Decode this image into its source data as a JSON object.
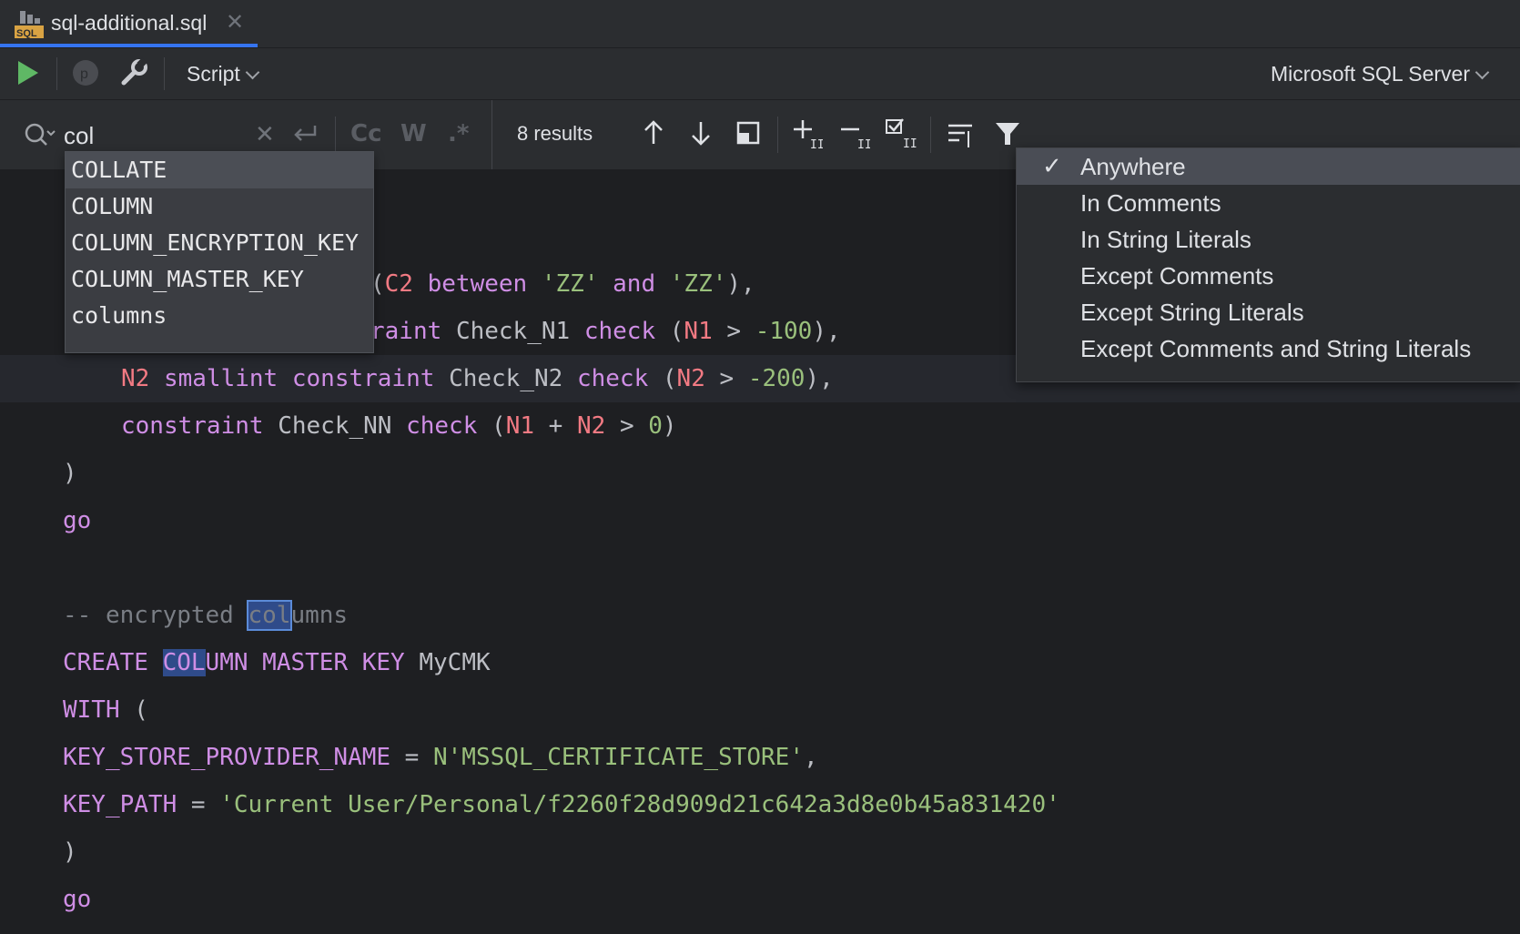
{
  "tab": {
    "filename": "sql-additional.sql",
    "icon": "sql-file-icon"
  },
  "toolbar": {
    "mode": "Script",
    "datasource": "Microsoft SQL Server"
  },
  "find": {
    "query": "col",
    "results": "8 results",
    "options": {
      "case": "Cc",
      "words": "W",
      "regex": ".*"
    }
  },
  "completion": {
    "items": [
      "COLLATE",
      "COLUMN",
      "COLUMN_ENCRYPTION_KEY",
      "COLUMN_MASTER_KEY",
      "columns"
    ]
  },
  "scope_menu": {
    "items": [
      "Anywhere",
      "In Comments",
      "In String Literals",
      "Except Comments",
      "Except String Literals",
      "Except Comments and String Literals"
    ],
    "selected": "Anywhere"
  },
  "code": {
    "l1_prefix": "(",
    "l1_c2": "C2",
    "l1_between": "between",
    "l1_zz1": "'ZZ'",
    "l1_and": "and",
    "l1_zz2": "'ZZ'",
    "l1_end": "),",
    "l2_raint": "raint",
    "l2_name": "Check_N1",
    "l2_check": "check",
    "l2_open": "(",
    "l2_n1": "N1",
    "l2_gt": ">",
    "l2_num": "-100",
    "l2_end": "),",
    "l3_n2": "N2",
    "l3_type": "smallint",
    "l3_constraint": "constraint",
    "l3_name": "Check_N2",
    "l3_check": "check",
    "l3_open": "(",
    "l3_n2b": "N2",
    "l3_gt": ">",
    "l3_num": "-200",
    "l3_end": "),",
    "l4_constraint": "constraint",
    "l4_name": "Check_NN",
    "l4_check": "check",
    "l4_open": "(",
    "l4_n1": "N1",
    "l4_plus": "+",
    "l4_n2": "N2",
    "l4_gt": ">",
    "l4_num": "0",
    "l4_end": ")",
    "l5": ")",
    "l6": "go",
    "l7_dash": "-- encrypted ",
    "l7_match": "col",
    "l7_rest": "umns",
    "l8_create": "CREATE",
    "l8_match": "COL",
    "l8_umn": "UMN",
    "l8_mk": "MASTER KEY",
    "l8_name": "MyCMK",
    "l9_with": "WITH",
    "l9_paren": " (",
    "l10_key": "KEY_STORE_PROVIDER_NAME",
    "l10_eq": " = ",
    "l10_val": "N'MSSQL_CERTIFICATE_STORE'",
    "l10_end": ",",
    "l11_key": "KEY_PATH",
    "l11_eq": " = ",
    "l11_val": "'Current User/Personal/f2260f28d909d21c642a3d8e0b45a831420'",
    "l12": ")",
    "l13": "go"
  },
  "colors": {
    "accent": "#3574f0",
    "run": "#5fb865",
    "keyword": "#cf8ee5",
    "column": "#f27a83",
    "string": "#9ac07c",
    "comment": "#7a7e85",
    "match": "#2f4b8a"
  }
}
